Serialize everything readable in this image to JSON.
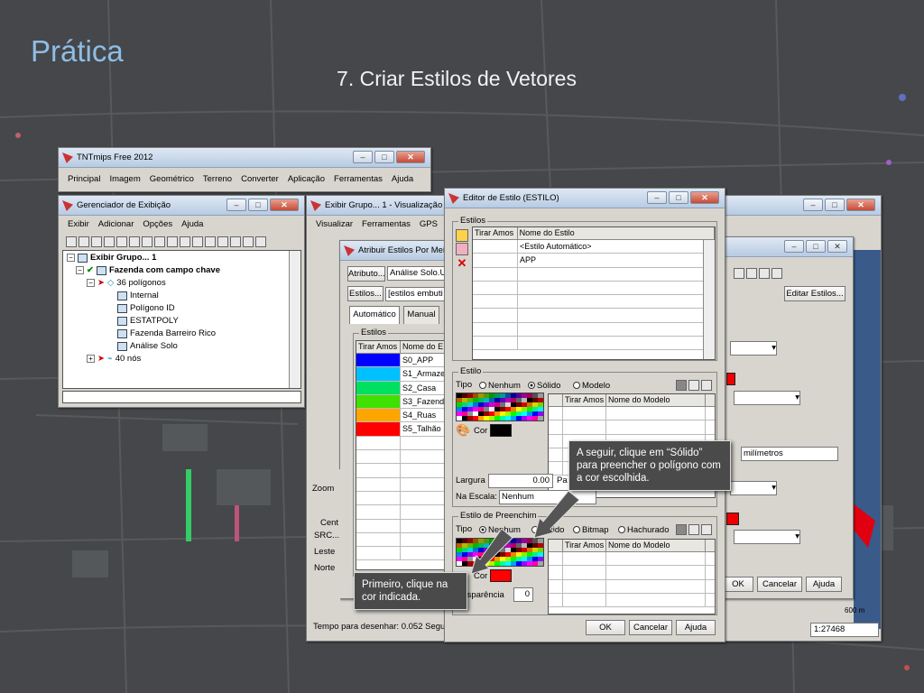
{
  "slide": {
    "title": "Prática",
    "subtitle": "7. Criar Estilos de Vetores"
  },
  "colors": {
    "title_blue": "#8fbde6",
    "bg": "#45474a"
  },
  "main_window": {
    "title": "TNTmips Free 2012",
    "menu": [
      "Principal",
      "Imagem",
      "Geométrico",
      "Terreno",
      "Converter",
      "Aplicação",
      "Ferramentas",
      "Ajuda"
    ]
  },
  "display_manager": {
    "title": "Gerenciador de Exibição",
    "menu": [
      "Exibir",
      "Adicionar",
      "Opções",
      "Ajuda"
    ],
    "tree": [
      "Exibir Grupo... 1",
      "Fazenda com campo chave",
      "36 polígonos",
      "Internal",
      "Polígono ID",
      "ESTATPOLY",
      "Fazenda Barreiro Rico",
      "Análise Solo",
      "40 nós"
    ]
  },
  "view_window": {
    "title": "Exibir Grupo... 1 - Visualização 1",
    "menu": [
      "Visualizar",
      "Ferramentas",
      "GPS"
    ],
    "side_labels": [
      "Zoom",
      "Cent",
      "SRC...",
      "Leste",
      "Norte"
    ],
    "status": "Tempo para desenhar: 0.052 Segu",
    "scale": "1:27468",
    "scalebar": "600 m"
  },
  "assign_styles": {
    "title": "Atribuir Estilos Por Meio",
    "attribute_button": "Atributo...",
    "attribute_value": "Análise Solo.U",
    "styles_button": "Estilos...",
    "styles_value": "[estilos embuti",
    "tabs": [
      "Automático",
      "Manual"
    ],
    "group_label": "Estilos",
    "columns": [
      "Tirar Amos",
      "Nome do E"
    ],
    "rows": [
      {
        "name": "S0_APP",
        "color": "#0000ff"
      },
      {
        "name": "S1_Armaze",
        "color": "#00c0ff"
      },
      {
        "name": "S2_Casa",
        "color": "#00e060"
      },
      {
        "name": "S3_Fazend",
        "color": "#40e000"
      },
      {
        "name": "S4_Ruas",
        "color": "#ffa500"
      },
      {
        "name": "S5_Talhão",
        "color": "#ff0000"
      }
    ]
  },
  "right_dialog": {
    "edit_styles": "Editar Estilos...",
    "units": "milímetros",
    "ok": "OK",
    "cancel": "Cancelar",
    "help": "Ajuda"
  },
  "style_editor": {
    "title": "Editor de Estilo (ESTILO)",
    "styles_group": "Estilos",
    "style_columns": [
      "Tirar Amos",
      "Nome do Estilo"
    ],
    "style_rows": [
      "<Estilo Automático>",
      "APP"
    ],
    "line_group": "Estilo",
    "type_label": "Tipo",
    "line_types": [
      "Nenhum",
      "Sólido",
      "Modelo"
    ],
    "model_columns": [
      "Tirar Amos",
      "Nome do Modelo"
    ],
    "color_label": "Cor",
    "width_label": "Largura",
    "width_value": "0.00",
    "width_suffix": "Pa",
    "scale_label": "Na Escala:",
    "scale_value": "Nenhum",
    "fill_group": "Estilo de Preenchim",
    "fill_types": [
      "Nenhum",
      "Sólido",
      "Bitmap",
      "Hachurado"
    ],
    "fill_color_label": "Cor",
    "transparency_label": "ansparência",
    "transparency_value": "0",
    "fill_color": "#ff0000",
    "line_color": "#000000",
    "ok": "OK",
    "cancel": "Cancelar",
    "help": "Ajuda"
  },
  "callouts": {
    "top": "A seguir, clique em “Sólido” para preencher o polígono com a cor escolhida.",
    "bottom": "Primeiro, clique na cor indicada."
  }
}
